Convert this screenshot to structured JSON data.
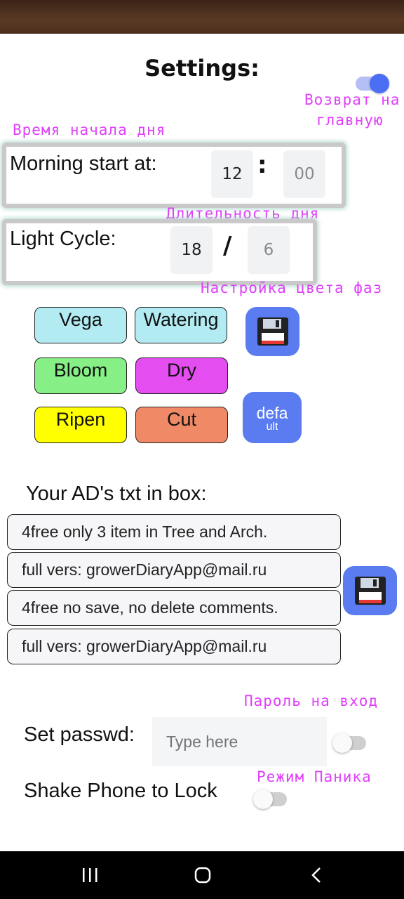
{
  "header": {
    "title": "Settings:"
  },
  "annotations": {
    "return_home": "Возврат на",
    "return_home_line2": "главную",
    "day_start_time": "Время начала дня",
    "day_length": "Длительность дня",
    "phase_color": "Настройка цвета фаз",
    "login_password": "Пароль на вход",
    "panic_mode": "Режим Паника"
  },
  "morning": {
    "label": "Morning start at:",
    "hour": "12",
    "separator": ":",
    "minute": "00"
  },
  "light_cycle": {
    "label": "Light Cycle:",
    "on_hours": "18",
    "separator": "/",
    "off_hours": "6"
  },
  "phases": [
    {
      "label": "Vega",
      "color": "#b2ebf2"
    },
    {
      "label": "Watering",
      "color": "#b2ebf2"
    },
    {
      "label": "Bloom",
      "color": "#86ef86"
    },
    {
      "label": "Dry",
      "color": "#e44ef0"
    },
    {
      "label": "Ripen",
      "color": "#ffff00"
    },
    {
      "label": "Cut",
      "color": "#f08a66"
    }
  ],
  "default_button": {
    "label": "defa",
    "label_line2": "ult"
  },
  "ads": {
    "heading": "Your AD's txt in box:",
    "lines": [
      "4free only 3 item in Tree and Arch.",
      "full vers: growerDiaryApp@mail.ru",
      "4free no save, no delete comments.",
      "full vers: growerDiaryApp@mail.ru"
    ]
  },
  "password": {
    "label": "Set passwd:",
    "placeholder": "Type here",
    "enabled": false
  },
  "shake_lock": {
    "label": "Shake Phone to Lock",
    "enabled": false
  },
  "home_toggle": {
    "enabled": true
  },
  "colors": {
    "accent": "#4c6ef5",
    "annotation": "#e040fb",
    "save_button": "#5b7cf0"
  },
  "icons": {
    "save": "floppy-disk-icon",
    "nav": [
      "recent-apps-icon",
      "home-icon",
      "back-icon"
    ]
  }
}
